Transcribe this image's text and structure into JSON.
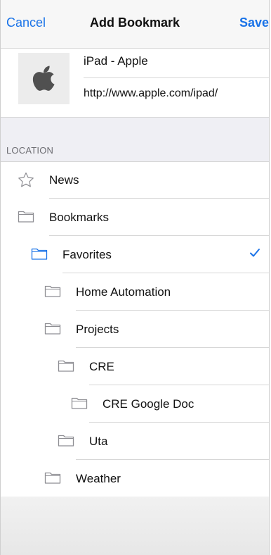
{
  "navbar": {
    "cancel_label": "Cancel",
    "title": "Add Bookmark",
    "save_label": "Save"
  },
  "bookmark": {
    "title": "iPad - Apple",
    "url": "http://www.apple.com/ipad/",
    "thumbnail_icon": "apple-logo-icon"
  },
  "section": {
    "label": "LOCATION"
  },
  "locations": [
    {
      "label": "News",
      "icon": "star-icon",
      "depth": 0,
      "selected": false
    },
    {
      "label": "Bookmarks",
      "icon": "folder-icon",
      "depth": 0,
      "selected": false
    },
    {
      "label": "Favorites",
      "icon": "folder-icon",
      "depth": 1,
      "selected": true
    },
    {
      "label": "Home Automation",
      "icon": "folder-icon",
      "depth": 2,
      "selected": false
    },
    {
      "label": "Projects",
      "icon": "folder-icon",
      "depth": 2,
      "selected": false
    },
    {
      "label": "CRE",
      "icon": "folder-icon",
      "depth": 3,
      "selected": false
    },
    {
      "label": "CRE Google Doc",
      "icon": "folder-icon",
      "depth": 4,
      "selected": false
    },
    {
      "label": "Uta",
      "icon": "folder-icon",
      "depth": 3,
      "selected": false
    },
    {
      "label": "Weather",
      "icon": "folder-icon",
      "depth": 2,
      "selected": false
    }
  ],
  "colors": {
    "accent": "#1a73e8",
    "separator": "#d6d6d6",
    "section_bg": "#efeff4"
  }
}
